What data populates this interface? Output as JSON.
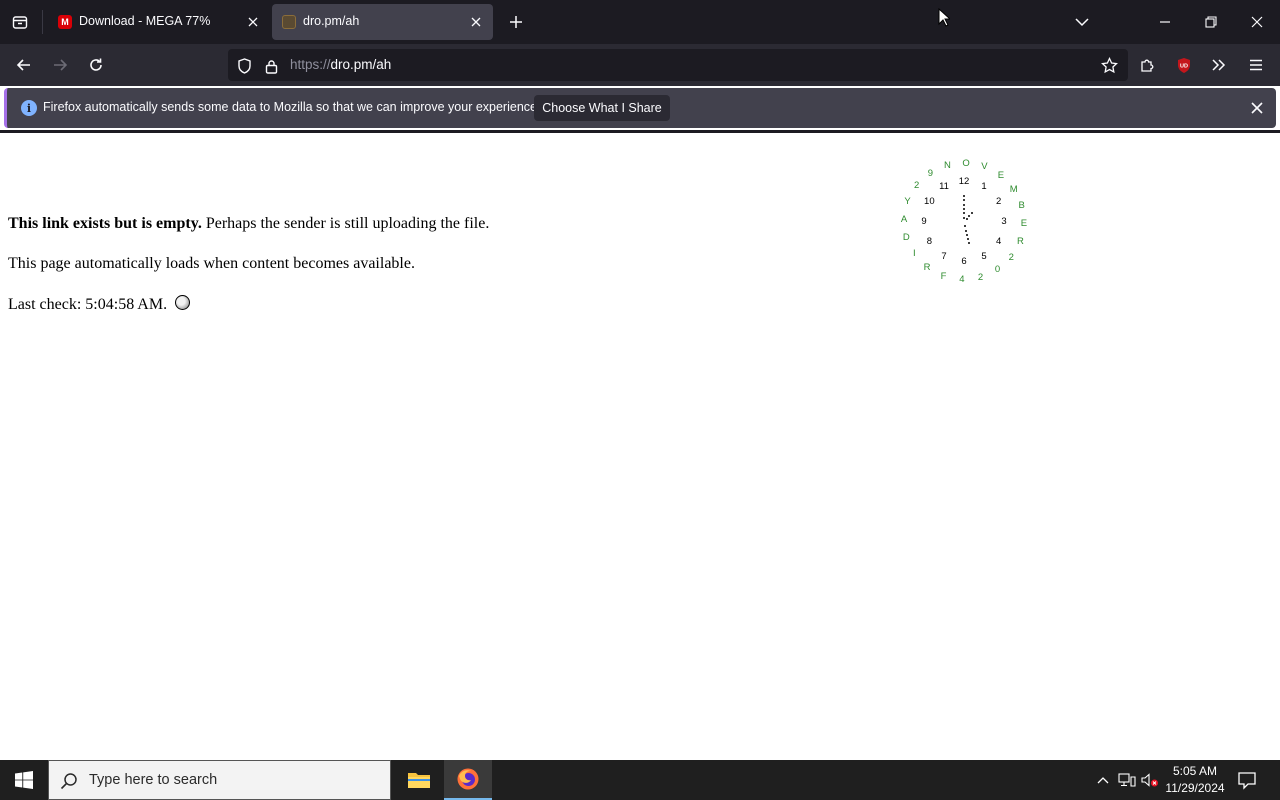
{
  "browser": {
    "tabs": [
      {
        "title": "Download - MEGA 77%",
        "favicon": "M",
        "active": false
      },
      {
        "title": "dro.pm/ah",
        "active": true
      }
    ],
    "url": {
      "scheme": "https://",
      "rest": "dro.pm/ah"
    },
    "infobar": {
      "message": "Firefox automatically sends some data to Mozilla so that we can improve your experience.",
      "button": "Choose What I Share"
    },
    "extension_badge": "UD"
  },
  "page": {
    "line1_bold": "This link exists but is empty.",
    "line1_rest": " Perhaps the sender is still uploading the file.",
    "line2": "This page automatically loads when content becomes available.",
    "line3": "Last check: 5:04:58 AM."
  },
  "clock_widget": {
    "numbers": [
      "12",
      "1",
      "2",
      "3",
      "4",
      "5",
      "6",
      "7",
      "8",
      "9",
      "10",
      "11"
    ],
    "date_letters": [
      "N",
      "O",
      "V",
      "E",
      "M",
      "B",
      "E",
      "R",
      "2",
      "0",
      "2",
      "4",
      "F",
      "R",
      "I",
      "D",
      "A",
      "Y",
      "2",
      "9"
    ]
  },
  "taskbar": {
    "search_placeholder": "Type here to search",
    "time": "5:05 AM",
    "date": "11/29/2024"
  },
  "colors": {
    "chrome_dark": "#1c1b22",
    "toolbar": "#2b2a33",
    "clock_letters": "#2e8b2e"
  }
}
